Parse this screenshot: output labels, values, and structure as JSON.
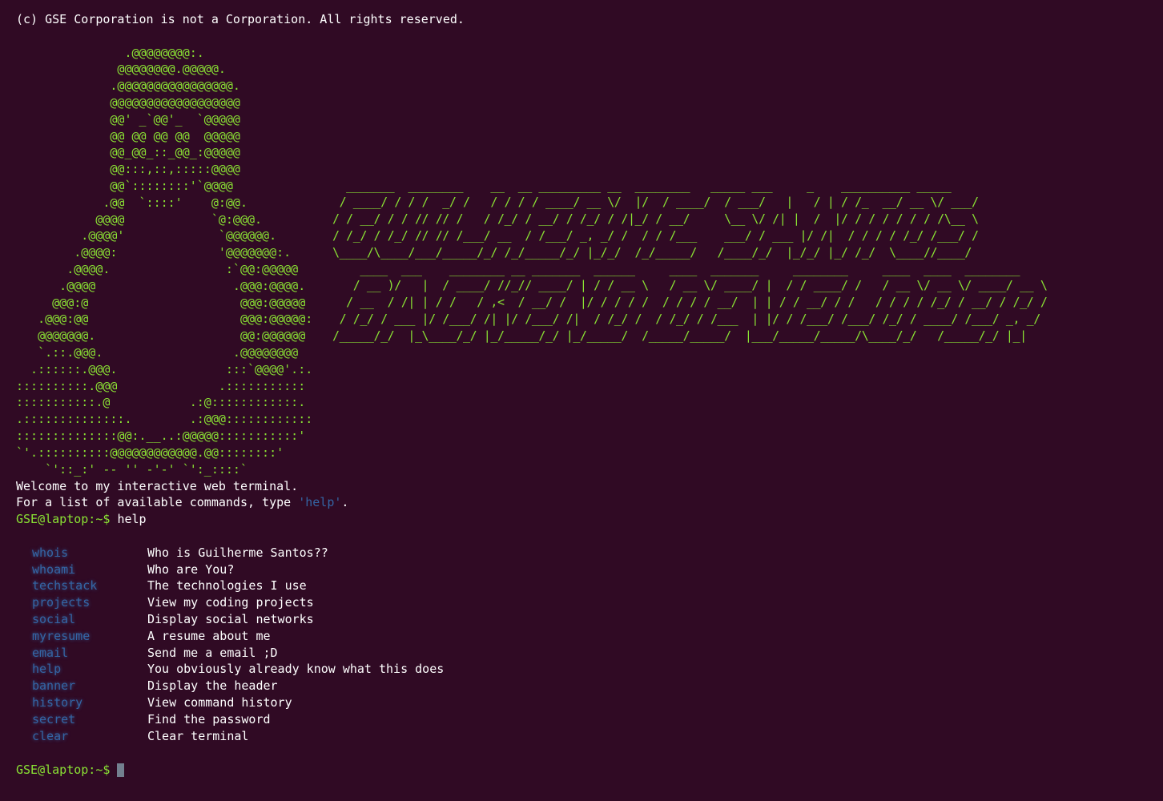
{
  "terminal": {
    "copyright": "(c) GSE Corporation is not a Corporation. All rights reserved.",
    "logo_art": "               .@@@@@@@@:.\n              @@@@@@@@.@@@@@.\n             .@@@@@@@@@@@@@@@@.\n             @@@@@@@@@@@@@@@@@@\n             @@' _`@@'_  `@@@@@\n             @@ @@ @@ @@  @@@@@\n             @@_@@_::_@@_:@@@@@\n             @@:::,::,:::::@@@@\n             @@`::::::::'`@@@@\n            .@@  `::::'    @:@@.\n           @@@@            `@:@@@.\n         .@@@@'             `@@@@@@.\n        .@@@@:              '@@@@@@@:.\n       .@@@@.                :`@@:@@@@@\n      .@@@@                   .@@@:@@@@.\n     @@@:@                     @@@:@@@@@\n   .@@@:@@                     @@@:@@@@@:\n   @@@@@@@.                    @@:@@@@@@\n   `.::.@@@.                  .@@@@@@@@\n  .::::::.@@@.               :::`@@@@'.:.\n::::::::::.@@@              .:::::::::::\n:::::::::::.@           .:@::::::::::::.\n.::::::::::::::.        .:@@@::::::::::::\n::::::::::::::@@:.__..:@@@@@:::::::::::'\n`'.::::::::::@@@@@@@@@@@@.@@::::::::'\n    `'::_:' -- '' -'-' `':_::::`",
    "title_art": "  _______  ________    __  __ _________ __  ________   _____ ___     _    __________ _____\n / ____/ / / /  _/ /   / / / / ____/ __ \\/  |/  / ____/  / ___/   |   / | / /_  __/ __ \\/ ___/\n/ / __/ / / // // /   / /_/ / __/ / /_/ / /|_/ / __/     \\__ \\/ /| |  /  |/ / / / / / / /\\__ \\\n/ /_/ / /_/ // // /___/ __  / /___/ _, _/ /  / / /___    ___/ / ___ |/ /|  / / / / /_/ /___/ /\n\\____/\\____/___/_____/_/ /_/_____/_/ |_/_/  /_/_____/   /____/_/  |_/_/ |_/ /_/  \\____//____/\n    ____  ___    ________ __ _______  ______     ____  _______     ________     ____  ____  ________\n   / __ )/   |  / ____/ //_// ____/ | / / __ \\   / __ \\/ ____/ |  / / ____/ /   / __ \\/ __ \\/ ____/ __ \\\n  / __  / /| | / /   / ,<  / __/ /  |/ / / / /  / / / / __/  | | / / __/ / /   / / / / /_/ / __/ / /_/ /\n / /_/ / ___ |/ /___/ /| |/ /___/ /|  / /_/ /  / /_/ / /___  | |/ / /___/ /___/ /_/ / ____/ /___/ _, _/\n/_____/_/  |_\\____/_/ |_/_____/_/ |_/_____/  /_____/_____/  |___/_____/_____/\\____/_/   /_____/_/ |_|",
    "welcome_line1": "Welcome to my interactive web terminal.",
    "welcome_line2_prefix": "For a list of available commands, type ",
    "welcome_line2_cmd": "'help'",
    "welcome_line2_suffix": ".",
    "prompt": "GSE@laptop:~$",
    "executed_command": "help",
    "help_rows": [
      {
        "cmd": "whois",
        "desc": "Who is Guilherme Santos??"
      },
      {
        "cmd": "whoami",
        "desc": "Who are You?"
      },
      {
        "cmd": "techstack",
        "desc": "The technologies I use"
      },
      {
        "cmd": "projects",
        "desc": "View my coding projects"
      },
      {
        "cmd": "social",
        "desc": "Display social networks"
      },
      {
        "cmd": "myresume",
        "desc": "A resume about me"
      },
      {
        "cmd": "email",
        "desc": "Send me a email ;D"
      },
      {
        "cmd": "help",
        "desc": "You obviously already know what this does"
      },
      {
        "cmd": "banner",
        "desc": "Display the header"
      },
      {
        "cmd": "history",
        "desc": "View command history"
      },
      {
        "cmd": "secret",
        "desc": "Find the password"
      },
      {
        "cmd": "clear",
        "desc": "Clear terminal"
      }
    ],
    "input_value": ""
  },
  "colors": {
    "background": "#300a24",
    "prompt_green": "#8ae234",
    "command_blue": "#3465a4",
    "text_white": "#ffffff"
  }
}
